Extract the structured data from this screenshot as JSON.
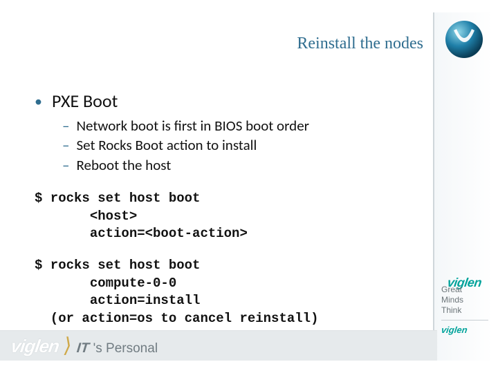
{
  "title": "Reinstall the nodes",
  "bullets": {
    "l1": "PXE Boot",
    "subs": [
      "Network boot is first in BIOS boot order",
      "Set Rocks Boot action to install",
      "Reboot the host"
    ]
  },
  "code1": "$ rocks set host boot\n       <host>\n       action=<boot-action>",
  "code2": "$ rocks set host boot\n       compute-0-0\n       action=install\n  (or action=os to cancel reinstall)",
  "brand": {
    "viglen": "viglen",
    "tag1": "Great",
    "tag2": "Minds",
    "tag3": "Think",
    "small": "viglen",
    "footer_viglen": "viglen",
    "footer_it": "IT",
    "footer_personal": "'s Personal"
  }
}
